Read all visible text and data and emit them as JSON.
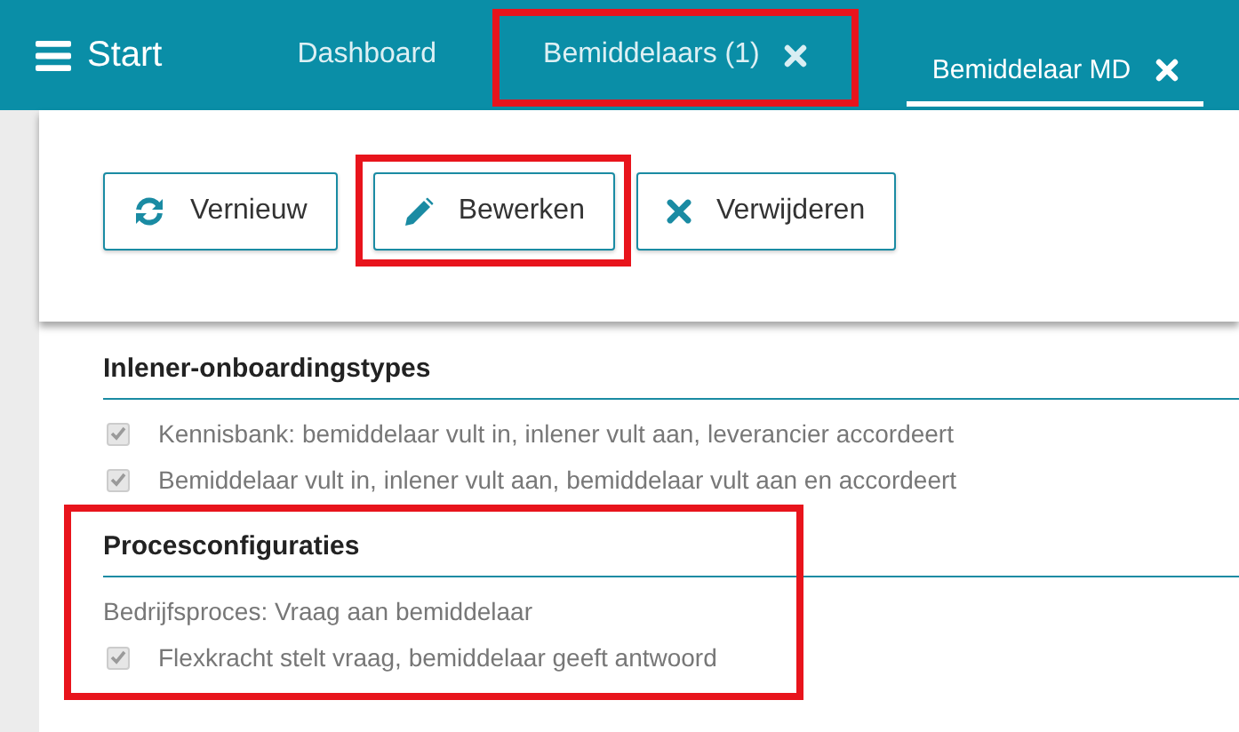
{
  "header": {
    "menu_label": "Start"
  },
  "tabs": [
    {
      "label": "Dashboard",
      "selected": false,
      "closable": false,
      "highlighted": false
    },
    {
      "label": "Bemiddelaars (1)",
      "selected": false,
      "closable": true,
      "highlighted": true
    },
    {
      "label": "Bemiddelaar MD",
      "selected": true,
      "closable": true,
      "highlighted": false
    }
  ],
  "toolbar": [
    {
      "label": "Vernieuw",
      "kind": "refresh",
      "highlighted": false
    },
    {
      "label": "Bewerken",
      "kind": "edit",
      "highlighted": true
    },
    {
      "label": "Verwijderen",
      "kind": "delete",
      "highlighted": false
    }
  ],
  "sections": [
    {
      "title": "Inlener-onboardingstypes",
      "highlighted": false,
      "items": [
        {
          "kind": "checkbox",
          "label": "Kennisbank: bemiddelaar vult in, inlener vult aan, leverancier accordeert",
          "checked": true
        },
        {
          "kind": "checkbox",
          "label": "Bemiddelaar vult in, inlener vult aan, bemiddelaar vult aan en accordeert",
          "checked": true
        }
      ]
    },
    {
      "title": "Procesconfiguraties",
      "highlighted": true,
      "items": [
        {
          "kind": "text",
          "label": "Bedrijfsproces: Vraag aan bemiddelaar"
        },
        {
          "kind": "checkbox",
          "label": "Flexkracht stelt vraag, bemiddelaar geeft antwoord",
          "checked": true
        }
      ]
    }
  ]
}
